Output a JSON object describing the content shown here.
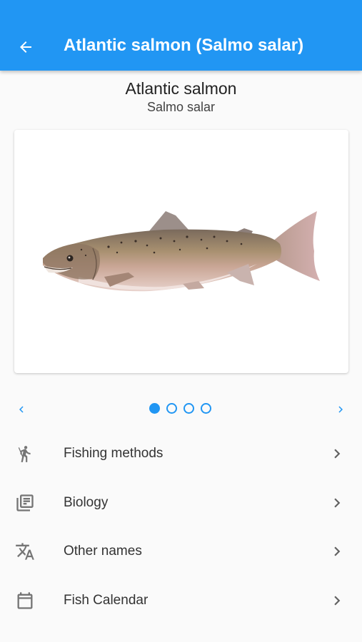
{
  "appbar": {
    "title": "Atlantic salmon (Salmo salar)",
    "back_icon": "arrow-left-icon"
  },
  "species": {
    "common_name": "Atlantic salmon",
    "scientific_name": "Salmo salar"
  },
  "gallery": {
    "total_images": 4,
    "current_index": 0,
    "prev_icon": "chevron-left-icon",
    "next_icon": "chevron-right-icon"
  },
  "menu": {
    "items": [
      {
        "label": "Fishing methods",
        "icon": "fisherman-icon"
      },
      {
        "label": "Biology",
        "icon": "library-books-icon"
      },
      {
        "label": "Other names",
        "icon": "translate-icon"
      },
      {
        "label": "Fish Calendar",
        "icon": "calendar-icon"
      }
    ]
  },
  "colors": {
    "primary": "#2196f3",
    "background": "#fafafa",
    "icon_gray": "#757575"
  }
}
